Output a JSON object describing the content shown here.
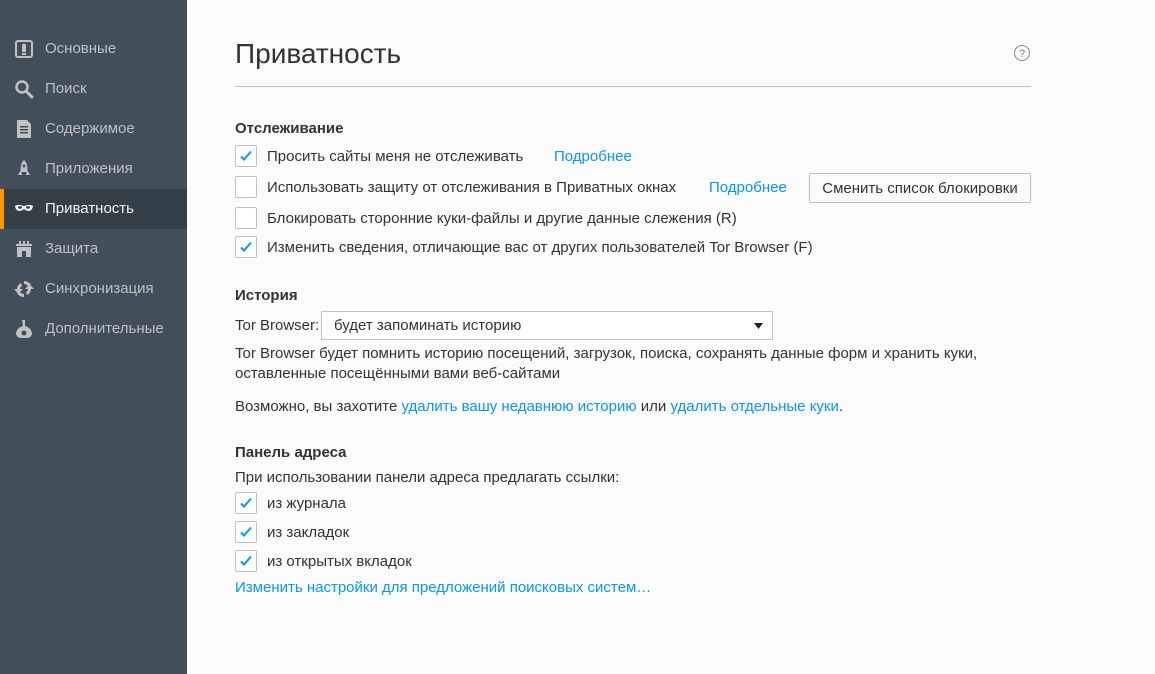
{
  "sidebar": {
    "items": [
      {
        "label": "Основные",
        "icon": "general-icon"
      },
      {
        "label": "Поиск",
        "icon": "search-icon"
      },
      {
        "label": "Содержимое",
        "icon": "content-icon"
      },
      {
        "label": "Приложения",
        "icon": "applications-icon"
      },
      {
        "label": "Приватность",
        "icon": "privacy-mask-icon",
        "selected": true
      },
      {
        "label": "Защита",
        "icon": "security-icon"
      },
      {
        "label": "Синхронизация",
        "icon": "sync-icon"
      },
      {
        "label": "Дополнительные",
        "icon": "advanced-icon"
      }
    ]
  },
  "header": {
    "title": "Приватность",
    "help_icon": "?"
  },
  "tracking": {
    "title": "Отслеживание",
    "do_not_track": {
      "label": "Просить сайты меня не отслеживать",
      "checked": true,
      "learn_more": "Подробнее"
    },
    "tracking_protection": {
      "label": "Использовать защиту от отслеживания в Приватных окнах",
      "checked": false,
      "learn_more": "Подробнее",
      "button": "Сменить список блокировки"
    },
    "block_cookies": {
      "label": "Блокировать сторонние куки-файлы и другие данные слежения (R)",
      "checked": false
    },
    "change_details": {
      "label": "Изменить сведения, отличающие вас от других пользователей Tor Browser (F)",
      "checked": true
    }
  },
  "history": {
    "title": "История",
    "select_label": "Tor Browser:",
    "select_value": "будет запоминать историю",
    "description_line1": "Tor Browser будет помнить историю посещений, загрузок, поиска, сохранять данные форм и хранить куки,",
    "description_line2": "оставленные посещёнными вами веб-сайтами",
    "maybe_prefix": "Возможно, вы захотите ",
    "clear_history_link": "удалить вашу недавнюю историю",
    "or_text": " или ",
    "remove_cookies_link": "удалить отдельные куки",
    "period": "."
  },
  "address_bar": {
    "title": "Панель адреса",
    "intro": "При использовании панели адреса предлагать ссылки:",
    "options": [
      {
        "label": "из журнала",
        "checked": true
      },
      {
        "label": "из закладок",
        "checked": true
      },
      {
        "label": "из открытых вкладок",
        "checked": true
      }
    ],
    "search_suggestions_link": "Изменить настройки для предложений поисковых систем…"
  },
  "colors": {
    "sidebar_bg": "#424f5a",
    "sidebar_selected_bg": "#343f48",
    "link": "#0996f8",
    "check": "#0996f8",
    "accent": "#ff9500"
  }
}
